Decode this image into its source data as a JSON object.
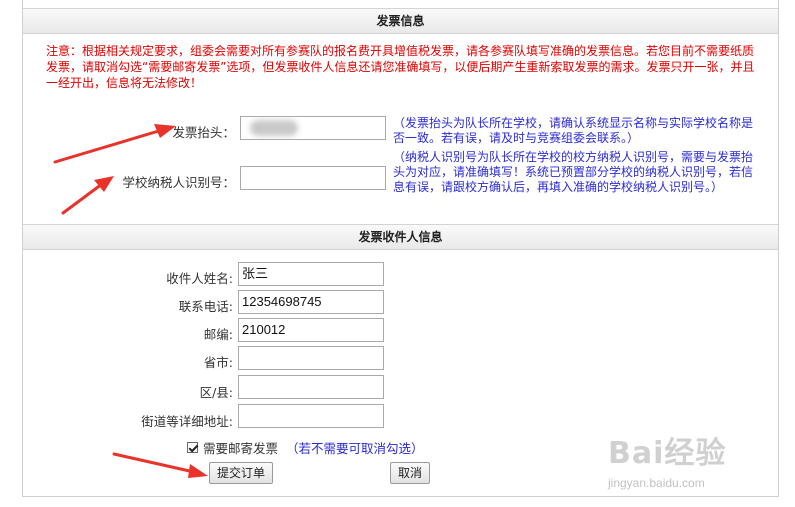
{
  "sections": {
    "invoice_title": "发票信息",
    "recipient_title": "发票收件人信息"
  },
  "notice": "注意：根据相关规定要求，组委会需要对所有参赛队的报名费开具增值税发票，请各参赛队填写准确的发票信息。若您目前不需要纸质发票，请取消勾选“需要邮寄发票”选项，但发票收件人信息还请您准确填写，以便后期产生重新索取发票的需求。发票只开一张，并且一经开出，信息将无法修改！",
  "invoice": {
    "title_label": "发票抬头：",
    "title_value": "",
    "title_hint": "（发票抬头为队长所在学校，请确认系统显示名称与实际学校名称是否一致。若有误，请及时与竞赛组委会联系。）",
    "tax_label": "学校纳税人识别号：",
    "tax_value": "",
    "tax_hint": "（纳税人识别号为队长所在学校的校方纳税人识别号，需要与发票抬头为对应，请准确填写！系统已预置部分学校的纳税人识别号，若信息有误，请跟校方确认后，再填入准确的学校纳税人识别号。）"
  },
  "recipient": {
    "name_label": "收件人姓名:",
    "name_value": "张三",
    "phone_label": "联系电话:",
    "phone_value": "12354698745",
    "zip_label": "邮编:",
    "zip_value": "210012",
    "province_label": "省市:",
    "province_value": "",
    "district_label": "区/县:",
    "district_value": "",
    "street_label": "街道等详细地址:",
    "street_value": ""
  },
  "mail": {
    "checked": true,
    "label": "需要邮寄发票",
    "hint": "（若不需要可取消勾选）"
  },
  "buttons": {
    "submit": "提交订单",
    "cancel": "取消"
  },
  "watermark": {
    "logo": "Bai经验",
    "url": "jingyan.baidu.com"
  },
  "colors": {
    "notice": "#e00000",
    "hint": "#2b2bd6",
    "arrow": "#e8322a"
  }
}
